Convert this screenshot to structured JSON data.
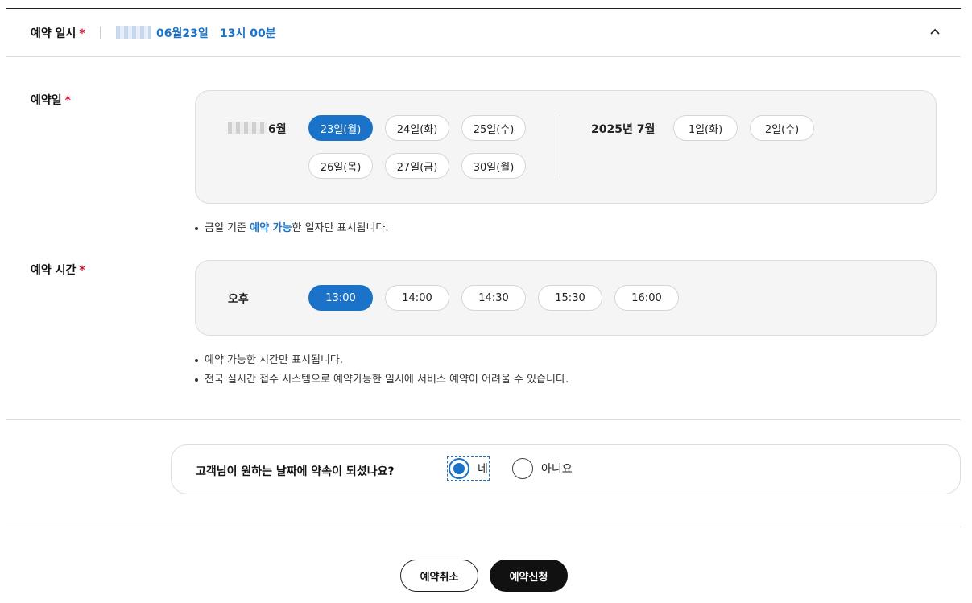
{
  "summary": {
    "label": "예약 일시",
    "required_mark": "*",
    "date_text": "06월23일",
    "time_text": "13시 00분",
    "collapse_icon": "chevron-up-icon"
  },
  "reservation_date": {
    "label": "예약일",
    "required_mark": "*",
    "months": [
      {
        "title": "6월",
        "days": [
          "23일(월)",
          "24일(화)",
          "25일(수)",
          "26일(목)",
          "27일(금)",
          "30일(월)"
        ],
        "selected_index": 0
      },
      {
        "title": "2025년 7월",
        "days": [
          "1일(화)",
          "2일(수)"
        ],
        "selected_index": null
      }
    ],
    "note": {
      "prefix": "금일 기준 ",
      "highlight": "예약 가능",
      "suffix": "한 일자만 표시됩니다."
    }
  },
  "reservation_time": {
    "label": "예약 시간",
    "required_mark": "*",
    "period": "오후",
    "slots": [
      "13:00",
      "14:00",
      "14:30",
      "15:30",
      "16:00"
    ],
    "selected_index": 0,
    "notes": [
      "예약 가능한 시간만 표시됩니다.",
      "전국 실시간 접수 시스템으로 예약가능한 일시에 서비스 예약이 어려울 수 있습니다."
    ]
  },
  "question": {
    "text": "고객님이 원하는 날짜에 약속이 되셨나요?",
    "options": [
      "네",
      "아니요"
    ],
    "selected_index": 0
  },
  "actions": {
    "cancel_label": "예약취소",
    "apply_label": "예약신청"
  },
  "colors": {
    "accent": "#1a73c8",
    "required": "#d0102b",
    "primary_button": "#111111"
  }
}
